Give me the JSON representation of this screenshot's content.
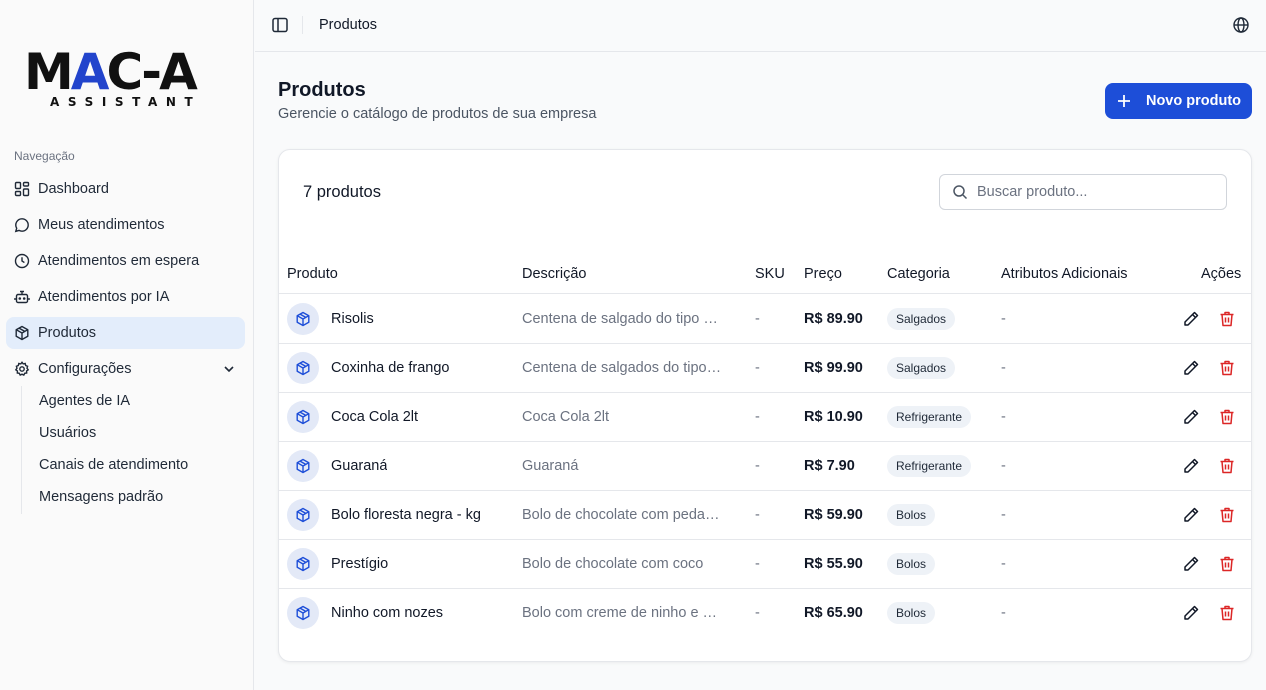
{
  "logo": {
    "main_left": "M",
    "main_accent": "A",
    "main_right": "C-A",
    "sub": "ASSISTANT"
  },
  "sidebar": {
    "heading": "Navegação",
    "items": [
      {
        "label": "Dashboard",
        "icon": "grid-icon"
      },
      {
        "label": "Meus atendimentos",
        "icon": "chat-icon"
      },
      {
        "label": "Atendimentos em espera",
        "icon": "clock-icon"
      },
      {
        "label": "Atendimentos por IA",
        "icon": "bot-icon"
      },
      {
        "label": "Produtos",
        "icon": "package-icon",
        "active": true
      },
      {
        "label": "Configurações",
        "icon": "gear-icon",
        "expanded": true
      }
    ],
    "sub_items": [
      "Agentes de IA",
      "Usuários",
      "Canais de atendimento",
      "Mensagens padrão"
    ]
  },
  "topbar": {
    "title": "Produtos"
  },
  "header": {
    "title": "Produtos",
    "subtitle": "Gerencie o catálogo de produtos de sua empresa",
    "new_button": "Novo produto"
  },
  "card": {
    "count": "7 produtos",
    "search_placeholder": "Buscar produto..."
  },
  "table": {
    "columns": [
      "Produto",
      "Descrição",
      "SKU",
      "Preço",
      "Categoria",
      "Atributos Adicionais",
      "Ações"
    ],
    "rows": [
      {
        "name": "Risolis",
        "description": "Centena de salgado do tipo risoles",
        "sku": "-",
        "price": "R$ 89.90",
        "category": "Salgados",
        "attrs": "-"
      },
      {
        "name": "Coxinha de frango",
        "description": "Centena de salgados do tipo coxinha",
        "sku": "-",
        "price": "R$ 99.90",
        "category": "Salgados",
        "attrs": "-"
      },
      {
        "name": "Coca Cola 2lt",
        "description": "Coca Cola 2lt",
        "sku": "-",
        "price": "R$ 10.90",
        "category": "Refrigerante",
        "attrs": "-"
      },
      {
        "name": "Guaraná",
        "description": "Guaraná",
        "sku": "-",
        "price": "R$ 7.90",
        "category": "Refrigerante",
        "attrs": "-"
      },
      {
        "name": "Bolo floresta negra - kg",
        "description": "Bolo de chocolate com pedaços de cereja",
        "sku": "-",
        "price": "R$ 59.90",
        "category": "Bolos",
        "attrs": "-"
      },
      {
        "name": "Prestígio",
        "description": "Bolo de chocolate com coco",
        "sku": "-",
        "price": "R$ 55.90",
        "category": "Bolos",
        "attrs": "-"
      },
      {
        "name": "Ninho com nozes",
        "description": "Bolo com creme de ninho e nozes",
        "sku": "-",
        "price": "R$ 65.90",
        "category": "Bolos",
        "attrs": "-"
      }
    ]
  },
  "colors": {
    "accent": "#1d4ed8",
    "active_bg": "#e3edfb",
    "danger": "#dc2626"
  }
}
